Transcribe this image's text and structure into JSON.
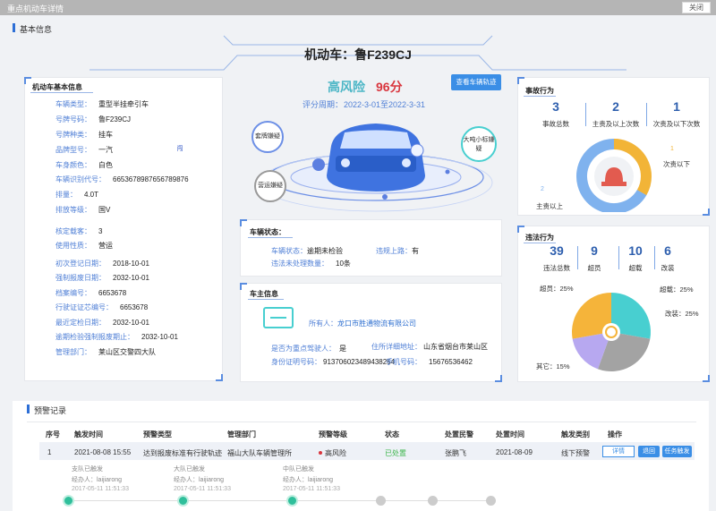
{
  "window": {
    "title": "重点机动车详情",
    "close_label": "关闭"
  },
  "basic_section": {
    "title": "基本信息"
  },
  "vehicle_header": {
    "title": "机动车：鲁F239CJ"
  },
  "vehicle_info": {
    "title": "机动车基本信息",
    "fields": [
      {
        "label": "车辆类型：",
        "value": "重型半挂牵引车"
      },
      {
        "label": "号牌号码：",
        "value": "鲁F239CJ"
      },
      {
        "label": "号牌种类：",
        "value": "挂车"
      },
      {
        "label": "品牌型号：",
        "value": "一汽"
      },
      {
        "label": "车身颜色：",
        "value": "白色"
      },
      {
        "label": "车辆识别代号：",
        "value": "6653678987656789876"
      },
      {
        "label": "排量：",
        "value": "4.0T"
      },
      {
        "label": "排放等级：",
        "value": "国V"
      },
      {
        "label": "核定载客：",
        "value": "3"
      },
      {
        "label": "使用性质：",
        "value": "营运"
      },
      {
        "label": "初次登记日期：",
        "value": "2018-10-01"
      },
      {
        "label": "强制报废日期：",
        "value": "2032-10-01"
      },
      {
        "label": "档案编号：",
        "value": "6653678"
      },
      {
        "label": "行驶证证芯编号：",
        "value": "6653678"
      },
      {
        "label": "最近定检日期：",
        "value": "2032-10-01"
      },
      {
        "label": "逾期检验强制报废期止：",
        "value": "2032-10-01"
      },
      {
        "label": "管理部门：",
        "value": "莱山区交警四大队"
      }
    ]
  },
  "risk": {
    "level": "高风险",
    "score": "96分",
    "period_label": "评分周期：",
    "period": "2022-3-01至2022-3-31",
    "track_button": "查看车辆轨迹",
    "tags": [
      "套牌嫌疑",
      "营运嫌疑",
      "大吨小标嫌疑"
    ],
    "car_tag": "闯"
  },
  "vehicle_status": {
    "title": "车辆状态：",
    "status_label": "车辆状态：",
    "status_value": "逾期未检验",
    "illegal_road_label": "违规上路：",
    "illegal_road_value": "有",
    "unprocessed_label": "违法未处理数量：",
    "unprocessed_value": "10条"
  },
  "owner": {
    "title": "车主信息",
    "owner_label": "所有人：",
    "owner_value": "龙口市胜通物流有限公司",
    "key_driver_label": "是否为重点驾驶人：",
    "key_driver_value": "是",
    "address_label": "住所详细地址：",
    "address_value": "山东省烟台市莱山区",
    "id_label": "身份证明号码：",
    "id_value": "913706023489438254",
    "phone_label": "手机号码：",
    "phone_value": "15676536462"
  },
  "accident": {
    "title": "事故行为",
    "stats": [
      {
        "value": "3",
        "label": "事故总数"
      },
      {
        "value": "2",
        "label": "主责及以上次数"
      },
      {
        "value": "1",
        "label": "次责及以下次数"
      }
    ],
    "donut_labels": {
      "major_value": "2",
      "major_label": "主责以上",
      "minor_value": "1",
      "minor_label": "次责以下"
    },
    "colors": {
      "major": "#7fb2ee",
      "minor": "#f2b437"
    }
  },
  "violation": {
    "title": "违法行为",
    "stats": [
      {
        "value": "39",
        "label": "违法总数"
      },
      {
        "value": "9",
        "label": "超员"
      },
      {
        "value": "10",
        "label": "超载"
      },
      {
        "value": "6",
        "label": "改装"
      }
    ],
    "pie": [
      {
        "name": "超员",
        "pct": "25%"
      },
      {
        "name": "超载",
        "pct": "25%"
      },
      {
        "name": "改装",
        "pct": "25%"
      },
      {
        "name": "其它",
        "pct": "15%"
      }
    ],
    "colors": [
      "#f5b43a",
      "#48cfd0",
      "#a3a3a3",
      "#b7a8f0"
    ]
  },
  "warnings": {
    "title": "预警记录",
    "headers": [
      "序号",
      "触发时间",
      "预警类型",
      "管理部门",
      "预警等级",
      "状态",
      "处置民警",
      "处置时间",
      "触发类别",
      "操作"
    ],
    "rows": [
      {
        "no": "1",
        "time": "2021-08-08 15:55",
        "type": "达到报废标准有行驶轨迹",
        "dept": "福山大队车辆管理所",
        "level": "高风险",
        "status": "已处置",
        "police": "张鹏飞",
        "handle_time": "2021-08-09",
        "category": "线下预警",
        "actions": [
          "详情",
          "退回",
          "任务触发"
        ]
      }
    ],
    "timeline": [
      {
        "title": "支队已触发",
        "operator": "经办人：laijiarong",
        "time": "2017-05-11 11:51:33"
      },
      {
        "title": "大队已触发",
        "operator": "经办人：laijiarong",
        "time": "2017-05-11 11:51:33"
      },
      {
        "title": "中队已触发",
        "operator": "经办人：laijiarong",
        "time": "2017-05-11 11:51:33"
      }
    ]
  }
}
